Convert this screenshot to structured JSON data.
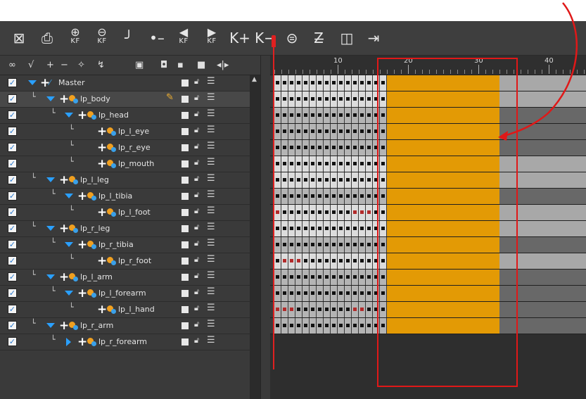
{
  "toolbar": {
    "items": [
      {
        "name": "create-empty-drawing-icon",
        "glyph": "⊠",
        "label": ""
      },
      {
        "name": "duplicate-drawing-icon",
        "glyph": "⎙",
        "label": ""
      },
      {
        "name": "add-keyframe-icon",
        "glyph": "⊕",
        "label": "KF"
      },
      {
        "name": "delete-keyframe-icon",
        "glyph": "⊖",
        "label": "KF"
      },
      {
        "name": "motion-keyframe-icon",
        "glyph": "╯",
        "label": ""
      },
      {
        "name": "stop-motion-keyframe-icon",
        "glyph": "•–•",
        "label": ""
      },
      {
        "name": "previous-keyframe-icon",
        "glyph": "◀",
        "label": "KF"
      },
      {
        "name": "next-keyframe-icon",
        "glyph": "▶",
        "label": "KF"
      },
      {
        "name": "insert-keyframe-icon",
        "glyph": "K+",
        "label": ""
      },
      {
        "name": "remove-keyframe-icon",
        "glyph": "K−",
        "label": ""
      },
      {
        "name": "onion-skin-icon",
        "glyph": "⊜",
        "label": ""
      },
      {
        "name": "ease-icon",
        "glyph": "Z̶",
        "label": ""
      },
      {
        "name": "layer-props-icon",
        "glyph": "◫",
        "label": ""
      },
      {
        "name": "extend-exposure-icon",
        "glyph": "⇥",
        "label": ""
      }
    ]
  },
  "layer_header": {
    "items": [
      {
        "name": "onion-skin-toggle-icon",
        "glyph": "∞"
      },
      {
        "name": "show-hide-all-icon",
        "glyph": "√"
      },
      {
        "name": "add-layer-icon",
        "glyph": "+"
      },
      {
        "name": "remove-layer-icon",
        "glyph": "−"
      },
      {
        "name": "add-peg-icon",
        "glyph": "✧"
      },
      {
        "name": "add-drawing-icon",
        "glyph": "↯"
      },
      {
        "name": "layer-menu-icon",
        "glyph": "▣"
      },
      {
        "name": "color-filter-icon",
        "glyph": "◘"
      },
      {
        "name": "small-dot-icon",
        "glyph": "▪"
      },
      {
        "name": "white-square-icon",
        "glyph": "■"
      },
      {
        "name": "collapse-panel-icon",
        "glyph": "◂|▸"
      }
    ]
  },
  "layers": [
    {
      "name": "Master",
      "depth": 0,
      "branch": false,
      "toggle": "down",
      "peg": "master"
    },
    {
      "name": "lp_body",
      "depth": 1,
      "branch": true,
      "toggle": "down",
      "peg": "peg",
      "pencil": true,
      "selected": true
    },
    {
      "name": "lp_head",
      "depth": 2,
      "branch": true,
      "toggle": "down",
      "peg": "peg"
    },
    {
      "name": "lp_l_eye",
      "depth": 3,
      "branch": true,
      "toggle": "none",
      "peg": "peg"
    },
    {
      "name": "lp_r_eye",
      "depth": 3,
      "branch": true,
      "toggle": "none",
      "peg": "peg"
    },
    {
      "name": "lp_mouth",
      "depth": 3,
      "branch": true,
      "toggle": "none",
      "peg": "peg"
    },
    {
      "name": "lp_l_leg",
      "depth": 1,
      "branch": true,
      "toggle": "down",
      "peg": "peg"
    },
    {
      "name": "lp_l_tibia",
      "depth": 2,
      "branch": true,
      "toggle": "down",
      "peg": "peg"
    },
    {
      "name": "lp_l_foot",
      "depth": 3,
      "branch": true,
      "toggle": "none",
      "peg": "peg"
    },
    {
      "name": "lp_r_leg",
      "depth": 1,
      "branch": true,
      "toggle": "down",
      "peg": "peg"
    },
    {
      "name": "lp_r_tibia",
      "depth": 2,
      "branch": true,
      "toggle": "down",
      "peg": "peg"
    },
    {
      "name": "lp_r_foot",
      "depth": 3,
      "branch": true,
      "toggle": "none",
      "peg": "peg"
    },
    {
      "name": "lp_l_arm",
      "depth": 1,
      "branch": true,
      "toggle": "down",
      "peg": "peg"
    },
    {
      "name": "lp_l_forearm",
      "depth": 2,
      "branch": true,
      "toggle": "down",
      "peg": "peg"
    },
    {
      "name": "lp_l_hand",
      "depth": 3,
      "branch": true,
      "toggle": "none",
      "peg": "peg"
    },
    {
      "name": "lp_r_arm",
      "depth": 1,
      "branch": true,
      "toggle": "down",
      "peg": "peg"
    },
    {
      "name": "lp_r_forearm",
      "depth": 2,
      "branch": true,
      "toggle": "right",
      "peg": "peg"
    }
  ],
  "timeline": {
    "ruler_labels": [
      "10",
      "20",
      "30",
      "40"
    ],
    "first_frame": 1,
    "last_visible_frame": 45,
    "current_frame": 1,
    "selected_range": [
      17,
      32
    ],
    "existing_frames": 16,
    "keyframe_rows": [
      {
        "light": true,
        "red": []
      },
      {
        "light": true,
        "red": []
      },
      {
        "light": false,
        "red": []
      },
      {
        "light": false,
        "red": []
      },
      {
        "light": false,
        "red": []
      },
      {
        "light": true,
        "red": []
      },
      {
        "light": true,
        "red": []
      },
      {
        "light": false,
        "red": []
      },
      {
        "light": true,
        "red": [
          1,
          12,
          13,
          14
        ]
      },
      {
        "light": true,
        "red": []
      },
      {
        "light": false,
        "red": []
      },
      {
        "light": true,
        "red": [
          2,
          3,
          4
        ]
      },
      {
        "light": false,
        "red": []
      },
      {
        "light": false,
        "red": []
      },
      {
        "light": false,
        "red": [
          1,
          2,
          3,
          12,
          13
        ]
      },
      {
        "light": false,
        "red": []
      }
    ]
  },
  "colors": {
    "selection": "#e39a05",
    "playhead": "#e02020",
    "annotation": "#e01818"
  }
}
